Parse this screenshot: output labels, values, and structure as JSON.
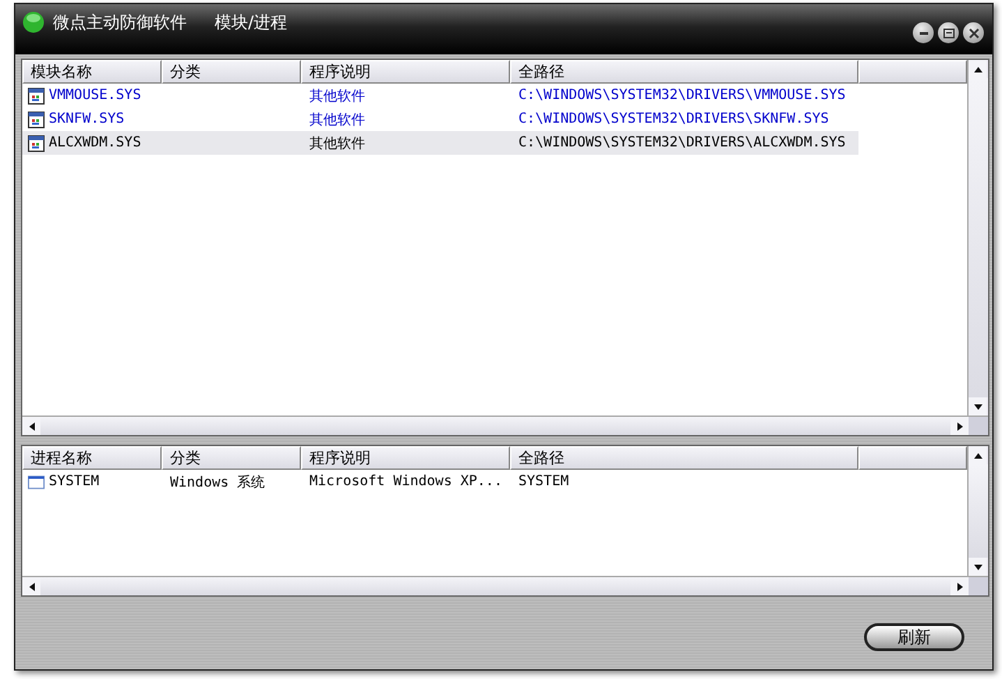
{
  "window": {
    "title": "微点主动防御软件",
    "subtitle": "模块/进程"
  },
  "modules": {
    "columns": [
      "模块名称",
      "分类",
      "程序说明",
      "全路径"
    ],
    "rows": [
      {
        "name": "VMMOUSE.SYS",
        "category": "",
        "description": "其他软件",
        "path": "C:\\WINDOWS\\SYSTEM32\\DRIVERS\\VMMOUSE.SYS",
        "color": "#0000cc",
        "selected": false
      },
      {
        "name": "SKNFW.SYS",
        "category": "",
        "description": "其他软件",
        "path": "C:\\WINDOWS\\SYSTEM32\\DRIVERS\\SKNFW.SYS",
        "color": "#0000cc",
        "selected": false
      },
      {
        "name": "ALCXWDM.SYS",
        "category": "",
        "description": "其他软件",
        "path": "C:\\WINDOWS\\SYSTEM32\\DRIVERS\\ALCXWDM.SYS",
        "color": "#000000",
        "selected": true
      }
    ]
  },
  "processes": {
    "columns": [
      "进程名称",
      "分类",
      "程序说明",
      "全路径"
    ],
    "rows": [
      {
        "name": "SYSTEM",
        "category": "Windows 系统",
        "description": "Microsoft Windows XP...",
        "path": "SYSTEM",
        "color": "#000000",
        "selected": false
      }
    ]
  },
  "buttons": [
    "刷新"
  ]
}
